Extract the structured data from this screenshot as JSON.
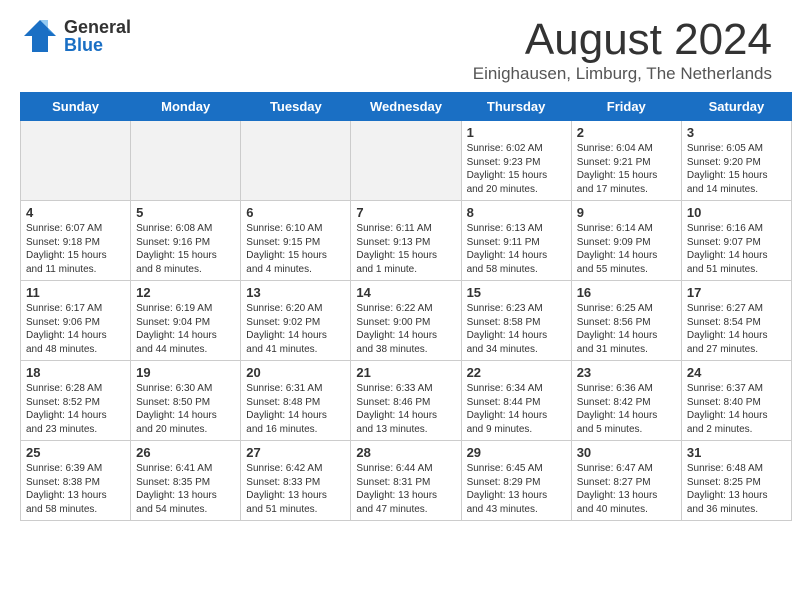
{
  "header": {
    "logo_general": "General",
    "logo_blue": "Blue",
    "month_year": "August 2024",
    "location": "Einighausen, Limburg, The Netherlands"
  },
  "days_of_week": [
    "Sunday",
    "Monday",
    "Tuesday",
    "Wednesday",
    "Thursday",
    "Friday",
    "Saturday"
  ],
  "weeks": [
    [
      {
        "day": "",
        "lines": []
      },
      {
        "day": "",
        "lines": []
      },
      {
        "day": "",
        "lines": []
      },
      {
        "day": "",
        "lines": []
      },
      {
        "day": "1",
        "lines": [
          "Sunrise: 6:02 AM",
          "Sunset: 9:23 PM",
          "Daylight: 15 hours",
          "and 20 minutes."
        ]
      },
      {
        "day": "2",
        "lines": [
          "Sunrise: 6:04 AM",
          "Sunset: 9:21 PM",
          "Daylight: 15 hours",
          "and 17 minutes."
        ]
      },
      {
        "day": "3",
        "lines": [
          "Sunrise: 6:05 AM",
          "Sunset: 9:20 PM",
          "Daylight: 15 hours",
          "and 14 minutes."
        ]
      }
    ],
    [
      {
        "day": "4",
        "lines": [
          "Sunrise: 6:07 AM",
          "Sunset: 9:18 PM",
          "Daylight: 15 hours",
          "and 11 minutes."
        ]
      },
      {
        "day": "5",
        "lines": [
          "Sunrise: 6:08 AM",
          "Sunset: 9:16 PM",
          "Daylight: 15 hours",
          "and 8 minutes."
        ]
      },
      {
        "day": "6",
        "lines": [
          "Sunrise: 6:10 AM",
          "Sunset: 9:15 PM",
          "Daylight: 15 hours",
          "and 4 minutes."
        ]
      },
      {
        "day": "7",
        "lines": [
          "Sunrise: 6:11 AM",
          "Sunset: 9:13 PM",
          "Daylight: 15 hours",
          "and 1 minute."
        ]
      },
      {
        "day": "8",
        "lines": [
          "Sunrise: 6:13 AM",
          "Sunset: 9:11 PM",
          "Daylight: 14 hours",
          "and 58 minutes."
        ]
      },
      {
        "day": "9",
        "lines": [
          "Sunrise: 6:14 AM",
          "Sunset: 9:09 PM",
          "Daylight: 14 hours",
          "and 55 minutes."
        ]
      },
      {
        "day": "10",
        "lines": [
          "Sunrise: 6:16 AM",
          "Sunset: 9:07 PM",
          "Daylight: 14 hours",
          "and 51 minutes."
        ]
      }
    ],
    [
      {
        "day": "11",
        "lines": [
          "Sunrise: 6:17 AM",
          "Sunset: 9:06 PM",
          "Daylight: 14 hours",
          "and 48 minutes."
        ]
      },
      {
        "day": "12",
        "lines": [
          "Sunrise: 6:19 AM",
          "Sunset: 9:04 PM",
          "Daylight: 14 hours",
          "and 44 minutes."
        ]
      },
      {
        "day": "13",
        "lines": [
          "Sunrise: 6:20 AM",
          "Sunset: 9:02 PM",
          "Daylight: 14 hours",
          "and 41 minutes."
        ]
      },
      {
        "day": "14",
        "lines": [
          "Sunrise: 6:22 AM",
          "Sunset: 9:00 PM",
          "Daylight: 14 hours",
          "and 38 minutes."
        ]
      },
      {
        "day": "15",
        "lines": [
          "Sunrise: 6:23 AM",
          "Sunset: 8:58 PM",
          "Daylight: 14 hours",
          "and 34 minutes."
        ]
      },
      {
        "day": "16",
        "lines": [
          "Sunrise: 6:25 AM",
          "Sunset: 8:56 PM",
          "Daylight: 14 hours",
          "and 31 minutes."
        ]
      },
      {
        "day": "17",
        "lines": [
          "Sunrise: 6:27 AM",
          "Sunset: 8:54 PM",
          "Daylight: 14 hours",
          "and 27 minutes."
        ]
      }
    ],
    [
      {
        "day": "18",
        "lines": [
          "Sunrise: 6:28 AM",
          "Sunset: 8:52 PM",
          "Daylight: 14 hours",
          "and 23 minutes."
        ]
      },
      {
        "day": "19",
        "lines": [
          "Sunrise: 6:30 AM",
          "Sunset: 8:50 PM",
          "Daylight: 14 hours",
          "and 20 minutes."
        ]
      },
      {
        "day": "20",
        "lines": [
          "Sunrise: 6:31 AM",
          "Sunset: 8:48 PM",
          "Daylight: 14 hours",
          "and 16 minutes."
        ]
      },
      {
        "day": "21",
        "lines": [
          "Sunrise: 6:33 AM",
          "Sunset: 8:46 PM",
          "Daylight: 14 hours",
          "and 13 minutes."
        ]
      },
      {
        "day": "22",
        "lines": [
          "Sunrise: 6:34 AM",
          "Sunset: 8:44 PM",
          "Daylight: 14 hours",
          "and 9 minutes."
        ]
      },
      {
        "day": "23",
        "lines": [
          "Sunrise: 6:36 AM",
          "Sunset: 8:42 PM",
          "Daylight: 14 hours",
          "and 5 minutes."
        ]
      },
      {
        "day": "24",
        "lines": [
          "Sunrise: 6:37 AM",
          "Sunset: 8:40 PM",
          "Daylight: 14 hours",
          "and 2 minutes."
        ]
      }
    ],
    [
      {
        "day": "25",
        "lines": [
          "Sunrise: 6:39 AM",
          "Sunset: 8:38 PM",
          "Daylight: 13 hours",
          "and 58 minutes."
        ]
      },
      {
        "day": "26",
        "lines": [
          "Sunrise: 6:41 AM",
          "Sunset: 8:35 PM",
          "Daylight: 13 hours",
          "and 54 minutes."
        ]
      },
      {
        "day": "27",
        "lines": [
          "Sunrise: 6:42 AM",
          "Sunset: 8:33 PM",
          "Daylight: 13 hours",
          "and 51 minutes."
        ]
      },
      {
        "day": "28",
        "lines": [
          "Sunrise: 6:44 AM",
          "Sunset: 8:31 PM",
          "Daylight: 13 hours",
          "and 47 minutes."
        ]
      },
      {
        "day": "29",
        "lines": [
          "Sunrise: 6:45 AM",
          "Sunset: 8:29 PM",
          "Daylight: 13 hours",
          "and 43 minutes."
        ]
      },
      {
        "day": "30",
        "lines": [
          "Sunrise: 6:47 AM",
          "Sunset: 8:27 PM",
          "Daylight: 13 hours",
          "and 40 minutes."
        ]
      },
      {
        "day": "31",
        "lines": [
          "Sunrise: 6:48 AM",
          "Sunset: 8:25 PM",
          "Daylight: 13 hours",
          "and 36 minutes."
        ]
      }
    ]
  ]
}
